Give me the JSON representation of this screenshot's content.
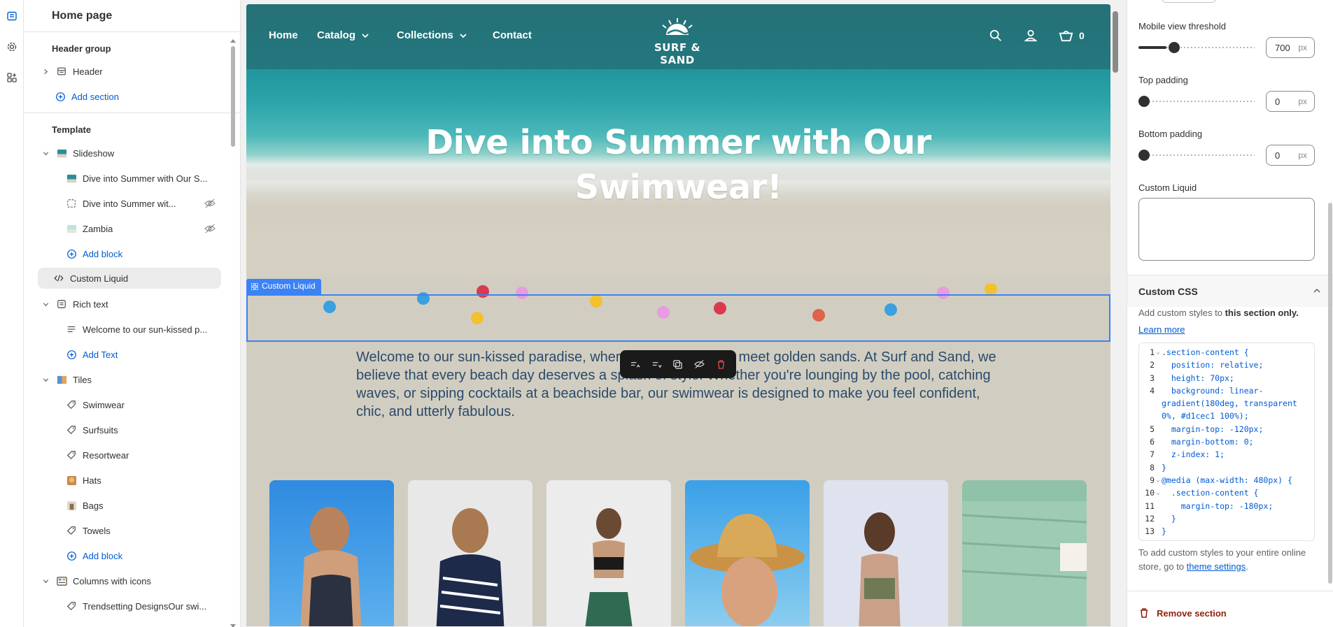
{
  "sidebar": {
    "title": "Home page",
    "header_group": "Header group",
    "header_item": "Header",
    "add_section": "Add section",
    "template_label": "Template",
    "slideshow": "Slideshow",
    "slide_1": "Dive into Summer with Our S...",
    "slide_2": "Dive into Summer wit...",
    "slide_3": "Zambia",
    "add_block": "Add block",
    "custom_liquid": "Custom Liquid",
    "rich_text": "Rich text",
    "rich_text_item": "Welcome to our sun-kissed p...",
    "add_text": "Add Text",
    "tiles": "Tiles",
    "tile_items": [
      "Swimwear",
      "Surfsuits",
      "Resortwear",
      "Hats",
      "Bags",
      "Towels"
    ],
    "add_block_2": "Add block",
    "columns": "Columns with icons",
    "columns_item": "Trendsetting DesignsOur swi..."
  },
  "preview": {
    "nav": [
      "Home",
      "Catalog",
      "Collections",
      "Contact"
    ],
    "logo_text": "SURF & SAND",
    "cart_count": "0",
    "hero_title": "Dive into Summer with Our Swimwear!",
    "selection_label": "Custom Liquid",
    "rich_text": "Welcome to our sun-kissed paradise, where turquoise waters meet golden sands. At Surf and Sand, we believe that every beach day deserves a splash of style. Whether you're lounging by the pool, catching waves, or sipping cocktails at a beachside bar, our swimwear is designed to make you feel confident, chic, and utterly fabulous."
  },
  "settings": {
    "mobile_threshold_label": "Mobile view threshold",
    "mobile_threshold_value": "700",
    "mobile_threshold_fraction": 0.22,
    "top_padding_label": "Top padding",
    "top_padding_value": "0",
    "bottom_padding_label": "Bottom padding",
    "bottom_padding_value": "0",
    "unit": "px",
    "custom_liquid_label": "Custom Liquid",
    "custom_css_title": "Custom CSS",
    "css_help_prefix": "Add custom styles to ",
    "css_help_bold": "this section only.",
    "learn_more": "Learn more",
    "code_lines": [
      ".section-content {",
      "  position: relative;",
      "  height: 70px;",
      "  background: linear-",
      "gradient(180deg, transparent",
      "0%, #d1cec1 100%);",
      "  margin-top: -120px;",
      "  margin-bottom: 0;",
      "  z-index: 1;",
      "}",
      "@media (max-width: 480px) {",
      "  .section-content {",
      "    margin-top: -180px;",
      "  }",
      "}"
    ],
    "code_line_numbers": [
      "1",
      "2",
      "3",
      "4",
      "",
      "",
      "5",
      "6",
      "7",
      "8",
      "9",
      "10",
      "11",
      "12",
      "13"
    ],
    "theme_help_prefix": "To add custom styles to your entire online store, go to ",
    "theme_settings": "theme settings",
    "remove_section": "Remove section"
  }
}
